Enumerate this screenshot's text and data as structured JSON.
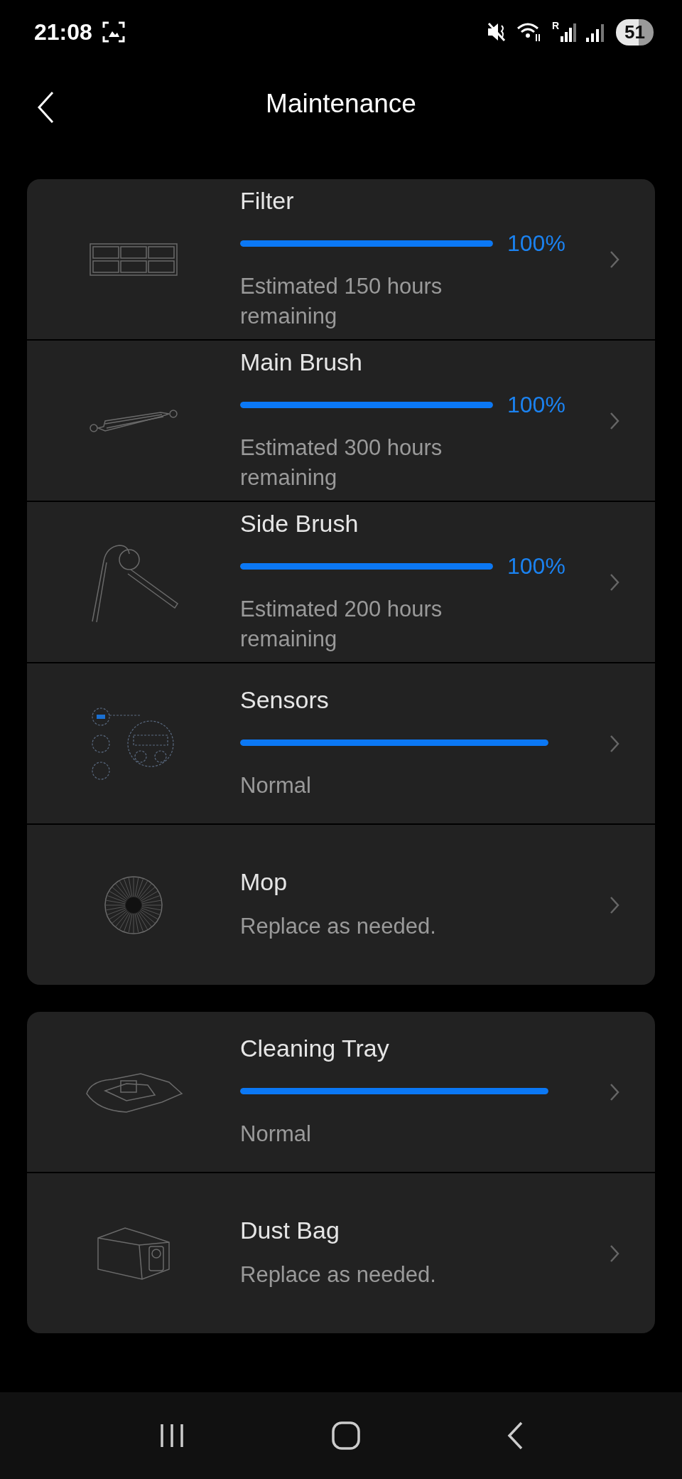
{
  "status_bar": {
    "time": "21:08",
    "roaming": "R",
    "battery": "51"
  },
  "header": {
    "title": "Maintenance"
  },
  "groups": [
    {
      "items": [
        {
          "kind": "meter",
          "title": "Filter",
          "level": 1,
          "percent": "100%",
          "status": "Estimated 150 hours remaining"
        },
        {
          "kind": "meter",
          "title": "Main Brush",
          "level": 1,
          "percent": "100%",
          "status": "Estimated 300 hours remaining"
        },
        {
          "kind": "meter",
          "title": "Side Brush",
          "level": 1,
          "percent": "100%",
          "status": "Estimated 200 hours remaining"
        },
        {
          "kind": "meter",
          "title": "Sensors",
          "level": 1,
          "status": "Normal"
        },
        {
          "kind": "note",
          "title": "Mop",
          "status": "Replace as needed."
        }
      ]
    },
    {
      "items": [
        {
          "kind": "meter",
          "title": "Cleaning Tray",
          "level": 1,
          "status": "Normal"
        },
        {
          "kind": "note",
          "title": "Dust Bag",
          "status": "Replace as needed."
        }
      ]
    }
  ]
}
